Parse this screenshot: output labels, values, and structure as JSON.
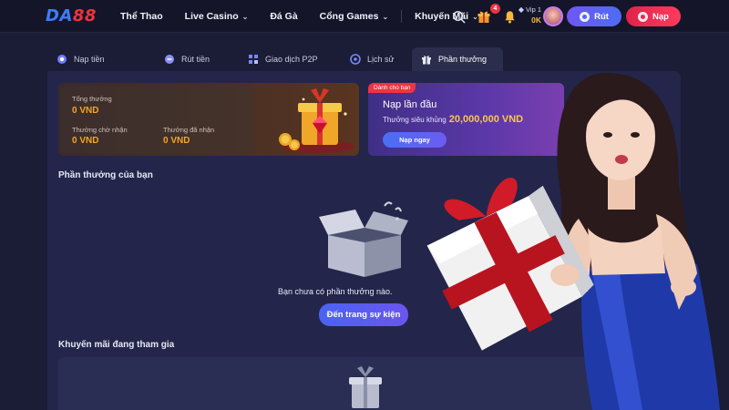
{
  "brand": {
    "logo_left": "DA",
    "logo_right": "88"
  },
  "nav": {
    "items": [
      {
        "label": "Thể Thao",
        "dropdown": false
      },
      {
        "label": "Live Casino",
        "dropdown": true
      },
      {
        "label": "Đá Gà",
        "dropdown": false
      },
      {
        "label": "Cổng Games",
        "dropdown": true
      },
      {
        "label": "Khuyến Mãi",
        "dropdown": true
      }
    ]
  },
  "header": {
    "icons": [
      "search-icon",
      "gift-icon",
      "bell-icon"
    ],
    "notification_count": "4",
    "vip_label": "Vip 1",
    "balance": "0K",
    "withdraw_label": "Rút",
    "deposit_label": "Nạp"
  },
  "tabs": [
    {
      "label": "Nạp tiền",
      "icon": "deposit-icon",
      "active": false
    },
    {
      "label": "Rút tiền",
      "icon": "withdraw-icon",
      "active": false
    },
    {
      "label": "Giao dịch P2P",
      "icon": "p2p-icon",
      "active": false
    },
    {
      "label": "Lịch sử",
      "icon": "history-icon",
      "active": false
    },
    {
      "label": "Phần thưởng",
      "icon": "gift-icon",
      "active": true
    }
  ],
  "reward_summary": {
    "total_label": "Tổng thưởng",
    "total_value": "0 VND",
    "pending_label": "Thưởng chờ nhận",
    "pending_value": "0 VND",
    "received_label": "Thưởng đã nhận",
    "received_value": "0 VND"
  },
  "promo": {
    "badge": "Dành cho bạn",
    "title": "Nạp lần đầu",
    "subtitle": "Thưởng siêu khủng",
    "amount": "20,000,000 VND",
    "button": "Nạp ngay"
  },
  "my_rewards": {
    "title": "Phần thưởng của bạn",
    "empty_text": "Bạn chưa có phần thưởng nào.",
    "button": "Đến trang sự kiện"
  },
  "active_promos": {
    "title": "Khuyến mãi đang tham gia"
  },
  "colors": {
    "background": "#1b1d36",
    "header": "#141528",
    "panel": "#23264a",
    "accent_blue": "#4e6cf3",
    "accent_red": "#ef3340",
    "gold": "#f5a524"
  }
}
